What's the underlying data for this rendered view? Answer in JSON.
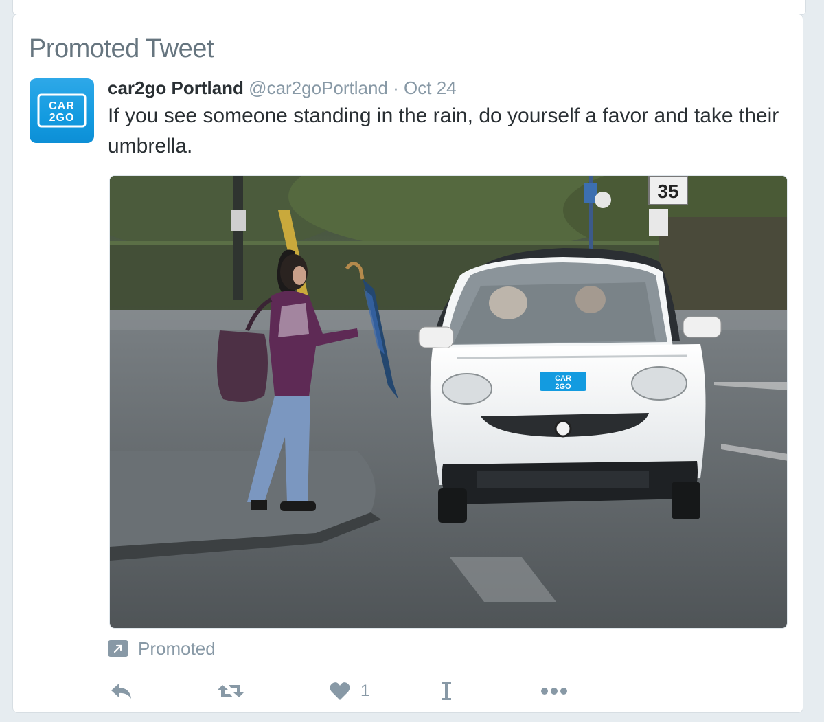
{
  "section": {
    "title": "Promoted Tweet"
  },
  "tweet": {
    "avatar": {
      "logo_line1": "CAR",
      "logo_line2": "2GO"
    },
    "display_name": "car2go Portland",
    "handle": "@car2goPortland",
    "separator": "·",
    "date": "Oct 24",
    "text": "If you see someone standing in the rain, do yourself a favor and take their umbrella.",
    "photo": {
      "speed_sign": "35",
      "car_door_logo_line1": "CAR",
      "car_door_logo_line2": "2GO"
    },
    "promoted_label": "Promoted",
    "actions": {
      "reply_icon": "reply-icon",
      "retweet_icon": "retweet-icon",
      "like_icon": "heart-icon",
      "like_count": "1",
      "analytics_icon": "analytics-icon",
      "more_icon": "more-icon"
    }
  },
  "colors": {
    "background": "#e6ecf0",
    "text": "#292f33",
    "secondary": "#8899a6",
    "brand_blue": "#139be0"
  }
}
